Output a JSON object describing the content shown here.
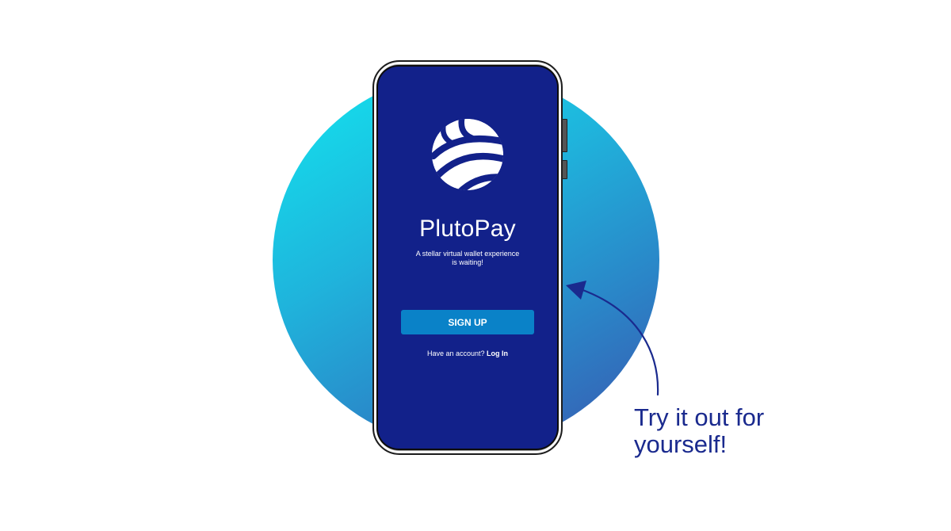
{
  "app": {
    "name": "PlutoPay",
    "tagline_line1": "A stellar virtual wallet experience",
    "tagline_line2": "is waiting!"
  },
  "actions": {
    "signup_label": "SIGN UP",
    "account_prompt": "Have an account?",
    "login_label": "Log In"
  },
  "callout": {
    "line1": "Try it out for",
    "line2": "yourself!"
  },
  "colors": {
    "screen_bg": "#12218a",
    "button_bg": "#0a82c8",
    "callout_text": "#1a2a8e",
    "circle_start": "#12e6ef",
    "circle_end": "#3a55ae"
  },
  "icons": {
    "logo": "plutopay-logo-icon",
    "arrow": "curved-arrow-icon"
  }
}
